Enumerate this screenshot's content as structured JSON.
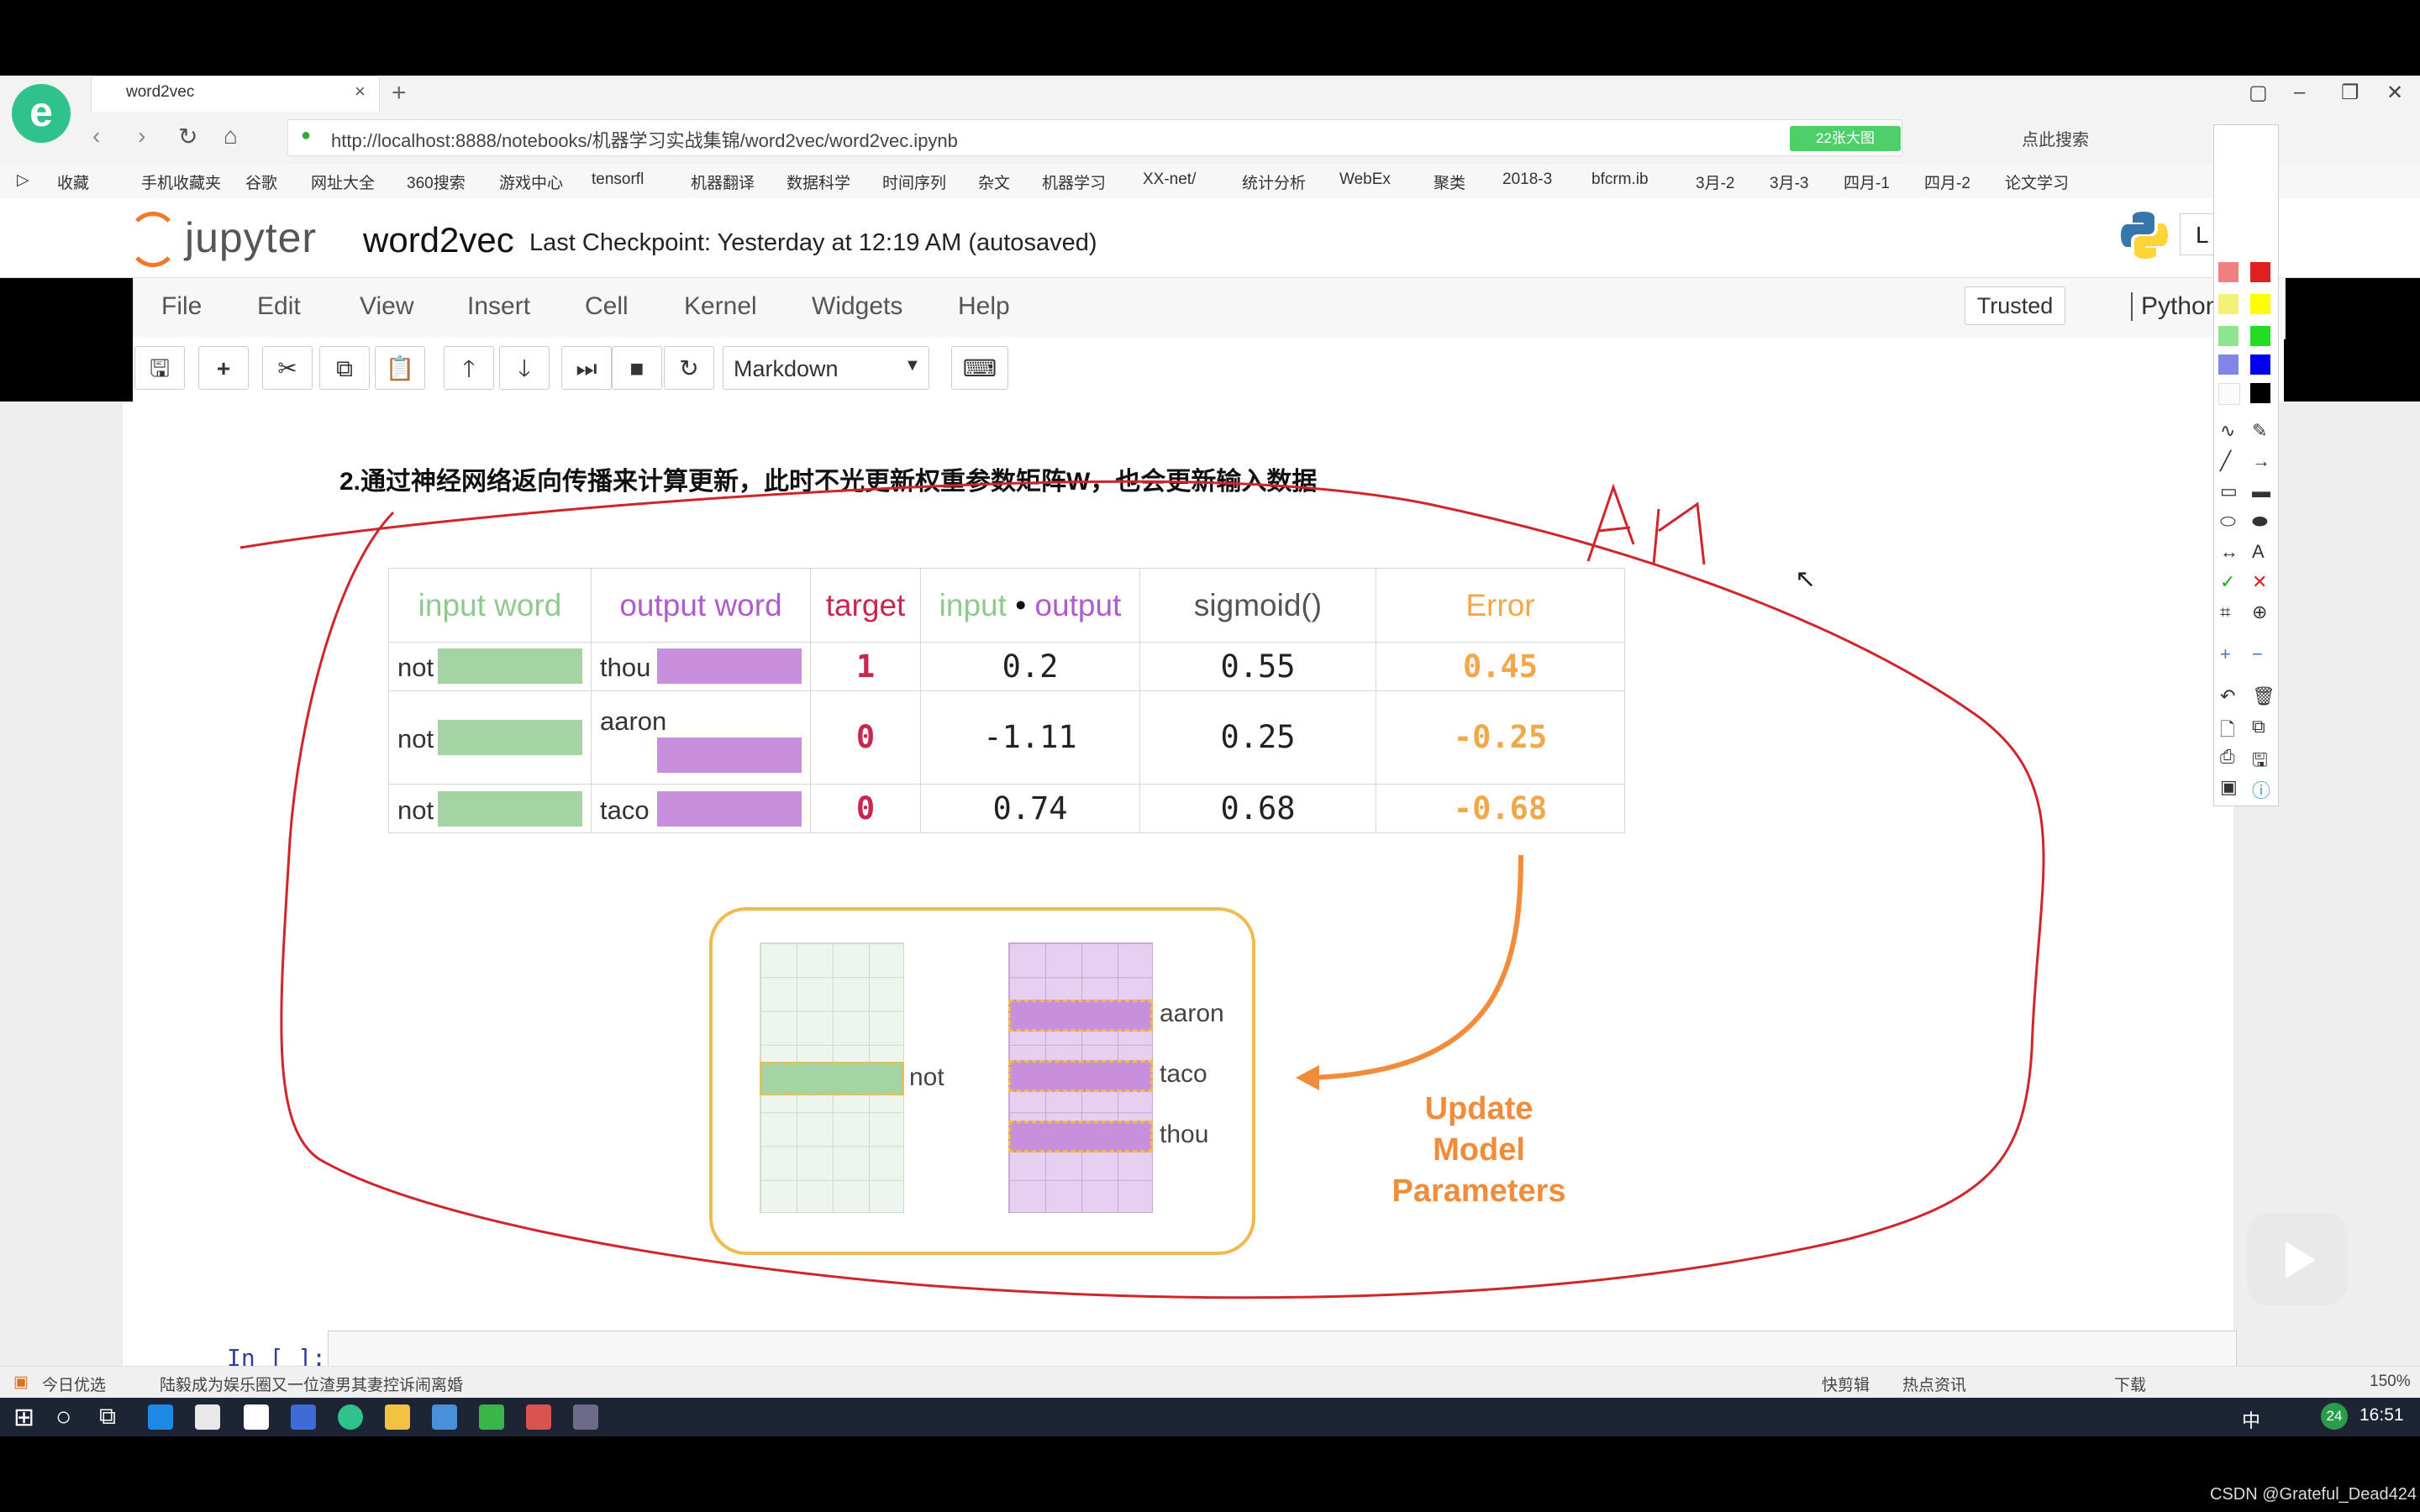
{
  "browser": {
    "tab_title": "word2vec",
    "tab_close": "×",
    "new_tab": "+",
    "url": "http://localhost:8888/notebooks/机器学习实战集锦/word2vec/word2vec.ipynb",
    "green_badge": "22张大图",
    "search_hint": "点此搜索",
    "bookmarks": [
      "收藏",
      "手机收藏夹",
      "谷歌",
      "网址大全",
      "360搜索",
      "游戏中心",
      "tensorfl",
      "机器翻译",
      "数据科学",
      "时间序列",
      "杂文",
      "机器学习",
      "XX-net/",
      "统计分析",
      "WebEx",
      "聚类",
      "2018-3",
      "bfcrm.ib",
      "3月-2",
      "3月-3",
      "四月-1",
      "四月-2",
      "论文学习"
    ]
  },
  "jupyter": {
    "logo": "jupyter",
    "notebook_title": "word2vec",
    "checkpoint": "Last Checkpoint: Yesterday at 12:19 AM (autosaved)",
    "menu": [
      "File",
      "Edit",
      "View",
      "Insert",
      "Cell",
      "Kernel",
      "Widgets",
      "Help"
    ],
    "trusted": "Trusted",
    "kernel": "Python",
    "logout": "L",
    "cell_type": "Markdown",
    "toolbar_icons": [
      "save-icon",
      "plus-icon",
      "scissors-icon",
      "copy-icon",
      "paste-icon",
      "arrow-up-icon",
      "arrow-down-icon",
      "run-icon",
      "stop-icon",
      "restart-icon",
      "keyboard-icon"
    ]
  },
  "content": {
    "step_text": "2.通过神经网络返向传播来计算更新，此时不光更新权重参数矩阵W，也会更新输入数据",
    "table": {
      "headers": {
        "input_word": "input word",
        "output_word": "output word",
        "target": "target",
        "input_dot": "input",
        "dot": "•",
        "output_dot": "output",
        "sigmoid": "sigmoid()",
        "error": "Error"
      },
      "rows": [
        {
          "input": "not",
          "output": "thou",
          "target": "1",
          "dot": "0.2",
          "sigmoid": "0.55",
          "error": "0.45"
        },
        {
          "input": "not",
          "output": "aaron",
          "target": "0",
          "dot": "-1.11",
          "sigmoid": "0.25",
          "error": "-0.25"
        },
        {
          "input": "not",
          "output": "taco",
          "target": "0",
          "dot": "0.74",
          "sigmoid": "0.68",
          "error": "-0.68"
        }
      ]
    },
    "diagram": {
      "input_label": "not",
      "output_labels": [
        "aaron",
        "taco",
        "thou"
      ],
      "update_lines": [
        "Update",
        "Model",
        "Parameters"
      ]
    },
    "in_prompt": "In [ ]:"
  },
  "status_bar": {
    "left": "今日优选",
    "news": "陆毅成为娱乐圈又一位渣男其妻控诉闹离婚",
    "right_items": [
      "快剪辑",
      "热点资讯",
      "下载"
    ],
    "zoom": "150%"
  },
  "taskbar": {
    "clock": "16:51",
    "ime": "中",
    "notification_count": "24"
  },
  "watermark": "CSDN @Grateful_Dead424",
  "colors": {
    "green_header": "#8fc98f",
    "purple_header": "#b05bcb",
    "target_red": "#c8274e",
    "error_orange": "#f0a84a",
    "annotation_red": "#d0262b"
  }
}
